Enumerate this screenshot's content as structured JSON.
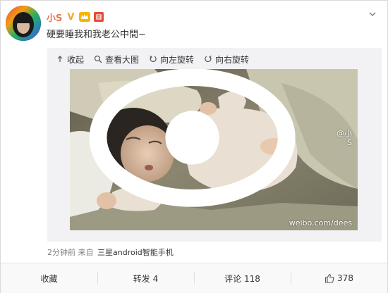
{
  "post": {
    "username": "小S",
    "verified_mark": "V",
    "text": "硬要睡我和我老公中間~"
  },
  "toolbar": {
    "collapse": "收起",
    "view_large": "查看大图",
    "rotate_left": "向左旋转",
    "rotate_right": "向右旋转"
  },
  "watermark": {
    "user": "@小S",
    "site": "weibo.com/dees"
  },
  "meta": {
    "time": "2分钟前",
    "from": "来自",
    "device": "三星android智能手机"
  },
  "actions": {
    "favorite": "收藏",
    "repost": "转发 4",
    "comment": "评论 118",
    "like_count": "378"
  },
  "colors": {
    "username": "#eb7350",
    "accent_badge": "#f7b500",
    "red_badge": "#e84b3c",
    "media_bg": "#f2f2f5"
  },
  "icons": [
    "chevron-down-icon",
    "collapse-arrow-icon",
    "magnifier-icon",
    "rotate-left-icon",
    "rotate-right-icon",
    "thumbs-up-icon",
    "weibo-eye-icon"
  ]
}
